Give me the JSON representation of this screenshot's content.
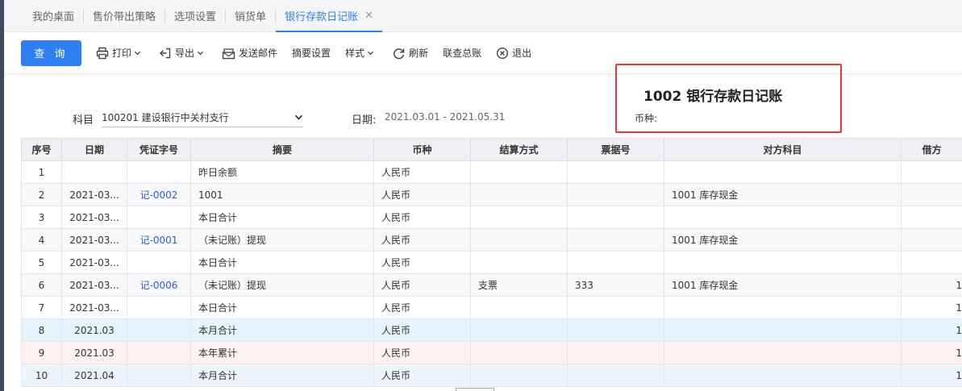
{
  "tabs": [
    {
      "label": "我的桌面",
      "active": false
    },
    {
      "label": "售价带出策略",
      "active": false
    },
    {
      "label": "选项设置",
      "active": false
    },
    {
      "label": "销货单",
      "active": false
    },
    {
      "label": "银行存款日记账",
      "active": true
    }
  ],
  "toolbar": {
    "query": "查 询",
    "print": "打印",
    "export": "导出",
    "send_mail": "发送邮件",
    "summary_settings": "摘要设置",
    "style": "样式",
    "refresh": "刷新",
    "ledger": "联查总账",
    "exit": "退出"
  },
  "report": {
    "title": "1002 银行存款日记账",
    "currency_label": "币种:",
    "subject_label": "科目",
    "subject_value": "100201 建设银行中关村支行",
    "date_label": "日期:",
    "date_value": "2021.03.01 - 2021.05.31"
  },
  "table": {
    "headers": [
      "序号",
      "日期",
      "凭证字号",
      "摘要",
      "币种",
      "结算方式",
      "票据号",
      "对方科目",
      "借方"
    ],
    "rows": [
      {
        "seq": "1",
        "date": "",
        "voucher": "",
        "summary": "昨日余额",
        "currency": "人民币",
        "settle": "",
        "bill": "",
        "account": "",
        "debit": ""
      },
      {
        "seq": "2",
        "date": "2021-03...",
        "voucher": "记-0002",
        "summary": "1001",
        "currency": "人民币",
        "settle": "",
        "bill": "",
        "account": "1001 库存现金",
        "debit": ""
      },
      {
        "seq": "3",
        "date": "2021-03...",
        "voucher": "",
        "summary": "本日合计",
        "currency": "人民币",
        "settle": "",
        "bill": "",
        "account": "",
        "debit": ""
      },
      {
        "seq": "4",
        "date": "2021-03...",
        "voucher": "记-0001",
        "summary": "（未记账）提现",
        "currency": "人民币",
        "settle": "",
        "bill": "",
        "account": "1001 库存现金",
        "debit": ""
      },
      {
        "seq": "5",
        "date": "2021-03...",
        "voucher": "",
        "summary": "本日合计",
        "currency": "人民币",
        "settle": "",
        "bill": "",
        "account": "",
        "debit": ""
      },
      {
        "seq": "6",
        "date": "2021-03...",
        "voucher": "记-0006",
        "summary": "（未记账）提现",
        "currency": "人民币",
        "settle": "支票",
        "bill": "333",
        "account": "1001 库存现金",
        "debit": "1"
      },
      {
        "seq": "7",
        "date": "2021-03...",
        "voucher": "",
        "summary": "本日合计",
        "currency": "人民币",
        "settle": "",
        "bill": "",
        "account": "",
        "debit": "1"
      },
      {
        "seq": "8",
        "date": "2021.03",
        "voucher": "",
        "summary": "本月合计",
        "currency": "人民币",
        "settle": "",
        "bill": "",
        "account": "",
        "debit": "1"
      },
      {
        "seq": "9",
        "date": "2021.03",
        "voucher": "",
        "summary": "本年累计",
        "currency": "人民币",
        "settle": "",
        "bill": "",
        "account": "",
        "debit": "1"
      },
      {
        "seq": "10",
        "date": "2021.04",
        "voucher": "",
        "summary": "本月合计",
        "currency": "人民币",
        "settle": "",
        "bill": "",
        "account": "",
        "debit": "1"
      }
    ]
  },
  "colors": {
    "accent": "#2d7ff2",
    "highlight_box": "#e53935",
    "link": "#2d5fd3"
  }
}
